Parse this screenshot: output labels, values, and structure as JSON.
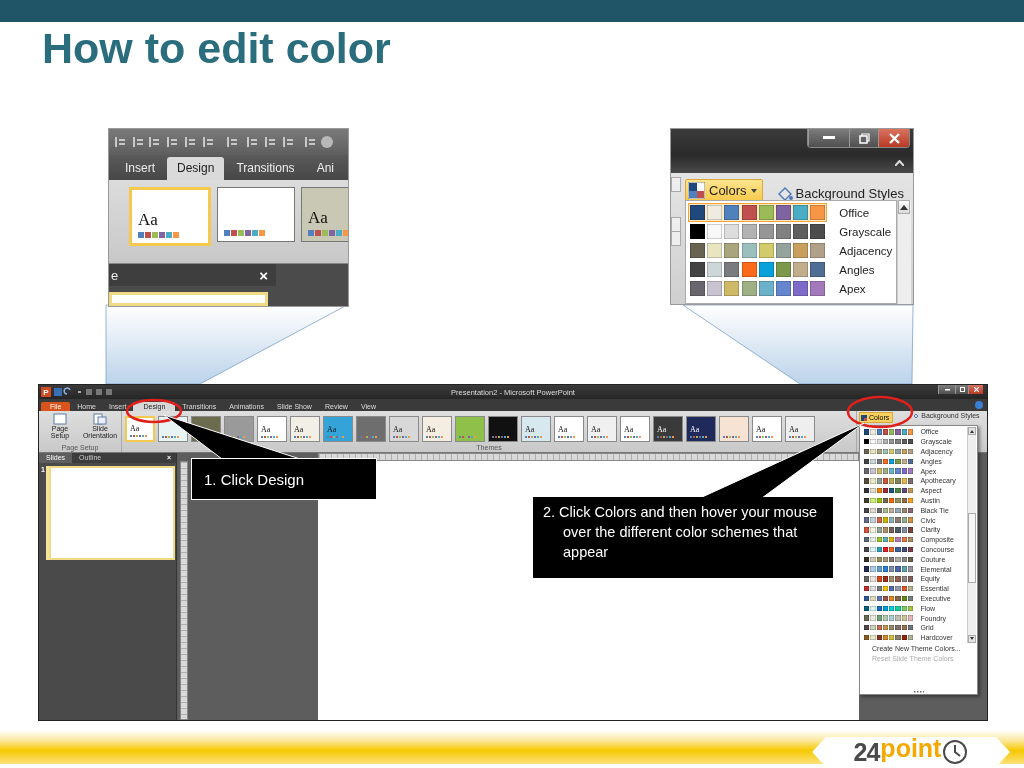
{
  "slide_title": "How to edit color",
  "design_closeup": {
    "tabs": [
      {
        "label": "Insert",
        "selected": false
      },
      {
        "label": "Design",
        "selected": true
      },
      {
        "label": "Transitions",
        "selected": false
      },
      {
        "label": "Ani",
        "selected": false
      }
    ],
    "themes": [
      {
        "label": "Aa",
        "color": "#ffffff",
        "selected": true
      },
      {
        "color": "#ffffff",
        "selected": false
      },
      {
        "label": "Aa",
        "color": "#c9c8b4",
        "selected": false
      }
    ],
    "pane_title": "e",
    "pane_close": "×"
  },
  "colors_closeup": {
    "colors_button": "Colors",
    "background_button": "Background Styles",
    "schemes": [
      {
        "name": "Office",
        "selected": true,
        "swatches": [
          {
            "color": "#1f497d"
          },
          {
            "color": "#eeece1"
          },
          {
            "color": "#4f81bd"
          },
          {
            "color": "#c0504d"
          },
          {
            "color": "#9bbb59"
          },
          {
            "color": "#8064a2"
          },
          {
            "color": "#4bacc6"
          },
          {
            "color": "#f79646"
          }
        ]
      },
      {
        "name": "Grayscale",
        "selected": false,
        "swatches": [
          {
            "color": "#000000"
          },
          {
            "color": "#f8f8f8"
          },
          {
            "color": "#dddddd"
          },
          {
            "color": "#b2b2b2"
          },
          {
            "color": "#969696"
          },
          {
            "color": "#808080"
          },
          {
            "color": "#5f5f5f"
          },
          {
            "color": "#4d4d4d"
          }
        ]
      },
      {
        "name": "Adjacency",
        "selected": false,
        "swatches": [
          {
            "color": "#696451"
          },
          {
            "color": "#e9e5c0"
          },
          {
            "color": "#a9a57c"
          },
          {
            "color": "#9cbebd"
          },
          {
            "color": "#d2cb6c"
          },
          {
            "color": "#95a39d"
          },
          {
            "color": "#c89f5d"
          },
          {
            "color": "#b1a089"
          }
        ]
      },
      {
        "name": "Angles",
        "selected": false,
        "swatches": [
          {
            "color": "#434343"
          },
          {
            "color": "#cdd7d9"
          },
          {
            "color": "#797b7e"
          },
          {
            "color": "#f96a1b"
          },
          {
            "color": "#08a1d9"
          },
          {
            "color": "#7c984a"
          },
          {
            "color": "#c2ad8d"
          },
          {
            "color": "#506e94"
          }
        ]
      },
      {
        "name": "Apex",
        "selected": false,
        "swatches": [
          {
            "color": "#69676d"
          },
          {
            "color": "#c9c2d1"
          },
          {
            "color": "#ceb966"
          },
          {
            "color": "#9cb084"
          },
          {
            "color": "#6bb1c9"
          },
          {
            "color": "#6585cf"
          },
          {
            "color": "#7e6bc9"
          },
          {
            "color": "#a379bb"
          }
        ]
      }
    ]
  },
  "window": {
    "app_icon": "P",
    "title": "Presentation2 - Microsoft PowerPoint",
    "tabs": [
      {
        "label": "File",
        "kind": "backstage",
        "selected": false
      },
      {
        "label": "Home",
        "kind": "tab",
        "selected": false
      },
      {
        "label": "Insert",
        "kind": "tab",
        "selected": false
      },
      {
        "label": "Design",
        "kind": "tab",
        "selected": true
      },
      {
        "label": "Transitions",
        "kind": "tab",
        "selected": false
      },
      {
        "label": "Animations",
        "kind": "tab",
        "selected": false
      },
      {
        "label": "Slide Show",
        "kind": "tab",
        "selected": false
      },
      {
        "label": "Review",
        "kind": "tab",
        "selected": false
      },
      {
        "label": "View",
        "kind": "tab",
        "selected": false
      }
    ],
    "page_setup_buttons": [
      "Page Setup",
      "Slide Orientation"
    ],
    "page_setup_group": "Page Setup",
    "themes": [
      {
        "label": "Aa",
        "color": "#ffffff",
        "selected": true
      },
      {
        "color": "#e8f4f4",
        "selected": false
      },
      {
        "color": "#6b6b4e",
        "selected": false
      },
      {
        "color": "#9a9a9a",
        "selected": false
      },
      {
        "label": "Aa",
        "color": "#ffffff",
        "selected": false
      },
      {
        "label": "Aa",
        "color": "#f2efe6",
        "selected": false
      },
      {
        "label": "Aa",
        "color": "#34a3d8",
        "selected": false
      },
      {
        "color": "#6e6e6e",
        "selected": false
      },
      {
        "label": "Aa",
        "color": "#d8d8d8",
        "selected": false
      },
      {
        "label": "Aa",
        "color": "#f4ede2",
        "selected": false
      },
      {
        "color": "#8fc14a",
        "selected": false
      },
      {
        "color": "#111111",
        "selected": false
      },
      {
        "label": "Aa",
        "color": "#d8e8ef",
        "selected": false
      },
      {
        "label": "Aa",
        "color": "#ffffff",
        "selected": false
      },
      {
        "label": "Aa",
        "color": "#f0f0f0",
        "selected": false
      },
      {
        "label": "Aa",
        "color": "#ffffff",
        "selected": false
      },
      {
        "label": "Aa",
        "color": "#3a3a3a",
        "selected": false
      },
      {
        "label": "Aa",
        "color": "#1f2a5a",
        "selected": false
      },
      {
        "color": "#f7e3d4",
        "selected": false
      },
      {
        "label": "Aa",
        "color": "#ffffff",
        "selected": false
      },
      {
        "label": "Aa",
        "color": "#eeeeee",
        "selected": false
      }
    ],
    "themes_group": "Themes",
    "colors_button": "Colors",
    "background_button": "Background Styles",
    "pane_tabs": [
      {
        "label": "Slides",
        "selected": true
      },
      {
        "label": "Outline",
        "selected": false
      }
    ],
    "pane_close": "×",
    "slide_number": "1",
    "color_menu": {
      "schemes": [
        {
          "name": "Office",
          "swatches": [
            {
              "color": "#1f497d"
            },
            {
              "color": "#eeece1"
            },
            {
              "color": "#4f81bd"
            },
            {
              "color": "#c0504d"
            },
            {
              "color": "#9bbb59"
            },
            {
              "color": "#8064a2"
            },
            {
              "color": "#4bacc6"
            },
            {
              "color": "#f79646"
            }
          ]
        },
        {
          "name": "Grayscale",
          "swatches": [
            {
              "color": "#000000"
            },
            {
              "color": "#f8f8f8"
            },
            {
              "color": "#dddddd"
            },
            {
              "color": "#b2b2b2"
            },
            {
              "color": "#969696"
            },
            {
              "color": "#808080"
            },
            {
              "color": "#5f5f5f"
            },
            {
              "color": "#4d4d4d"
            }
          ]
        },
        {
          "name": "Adjacency",
          "swatches": [
            {
              "color": "#696451"
            },
            {
              "color": "#e9e5c0"
            },
            {
              "color": "#a9a57c"
            },
            {
              "color": "#9cbebd"
            },
            {
              "color": "#d2cb6c"
            },
            {
              "color": "#95a39d"
            },
            {
              "color": "#c89f5d"
            },
            {
              "color": "#b1a089"
            }
          ]
        },
        {
          "name": "Angles",
          "swatches": [
            {
              "color": "#434343"
            },
            {
              "color": "#cdd7d9"
            },
            {
              "color": "#797b7e"
            },
            {
              "color": "#f96a1b"
            },
            {
              "color": "#08a1d9"
            },
            {
              "color": "#7c984a"
            },
            {
              "color": "#c2ad8d"
            },
            {
              "color": "#506e94"
            }
          ]
        },
        {
          "name": "Apex",
          "swatches": [
            {
              "color": "#69676d"
            },
            {
              "color": "#c9c2d1"
            },
            {
              "color": "#ceb966"
            },
            {
              "color": "#9cb084"
            },
            {
              "color": "#6bb1c9"
            },
            {
              "color": "#6585cf"
            },
            {
              "color": "#7e6bc9"
            },
            {
              "color": "#a379bb"
            }
          ]
        },
        {
          "name": "Apothecary",
          "swatches": [
            {
              "color": "#564b3c"
            },
            {
              "color": "#ece9c6"
            },
            {
              "color": "#93a299"
            },
            {
              "color": "#cf543f"
            },
            {
              "color": "#b5ae53"
            },
            {
              "color": "#848058"
            },
            {
              "color": "#e8b54d"
            },
            {
              "color": "#786c71"
            }
          ]
        },
        {
          "name": "Aspect",
          "swatches": [
            {
              "color": "#323232"
            },
            {
              "color": "#e3ded1"
            },
            {
              "color": "#f07f09"
            },
            {
              "color": "#9f2936"
            },
            {
              "color": "#1b587c"
            },
            {
              "color": "#4e8542"
            },
            {
              "color": "#604878"
            },
            {
              "color": "#c19859"
            }
          ]
        },
        {
          "name": "Austin",
          "swatches": [
            {
              "color": "#3e3d2d"
            },
            {
              "color": "#caf278"
            },
            {
              "color": "#94c600"
            },
            {
              "color": "#71685a"
            },
            {
              "color": "#ff6700"
            },
            {
              "color": "#909465"
            },
            {
              "color": "#956b43"
            },
            {
              "color": "#fea022"
            }
          ]
        },
        {
          "name": "Black Tie",
          "swatches": [
            {
              "color": "#46464a"
            },
            {
              "color": "#e3dccf"
            },
            {
              "color": "#6f6f74"
            },
            {
              "color": "#a7b789"
            },
            {
              "color": "#beae98"
            },
            {
              "color": "#92a9b9"
            },
            {
              "color": "#9c8265"
            },
            {
              "color": "#8d6974"
            }
          ]
        },
        {
          "name": "Civic",
          "swatches": [
            {
              "color": "#646b86"
            },
            {
              "color": "#c5d1d7"
            },
            {
              "color": "#d16349"
            },
            {
              "color": "#ccb400"
            },
            {
              "color": "#8cadae"
            },
            {
              "color": "#8c7b70"
            },
            {
              "color": "#8fb08c"
            },
            {
              "color": "#d19049"
            }
          ]
        },
        {
          "name": "Clarity",
          "swatches": [
            {
              "color": "#d2533c"
            },
            {
              "color": "#f3f2dc"
            },
            {
              "color": "#93a299"
            },
            {
              "color": "#ad8f67"
            },
            {
              "color": "#726056"
            },
            {
              "color": "#4c5a6a"
            },
            {
              "color": "#808da0"
            },
            {
              "color": "#79463d"
            }
          ]
        },
        {
          "name": "Composite",
          "swatches": [
            {
              "color": "#5b6973"
            },
            {
              "color": "#e7ecec"
            },
            {
              "color": "#98c723"
            },
            {
              "color": "#59b0b9"
            },
            {
              "color": "#deae00"
            },
            {
              "color": "#b77bb4"
            },
            {
              "color": "#e0773c"
            },
            {
              "color": "#a98d63"
            }
          ]
        },
        {
          "name": "Concourse",
          "swatches": [
            {
              "color": "#464646"
            },
            {
              "color": "#def5fa"
            },
            {
              "color": "#2da2bf"
            },
            {
              "color": "#da1f28"
            },
            {
              "color": "#eb641b"
            },
            {
              "color": "#39639d"
            },
            {
              "color": "#474b78"
            },
            {
              "color": "#7d3c4a"
            }
          ]
        },
        {
          "name": "Couture",
          "swatches": [
            {
              "color": "#37302a"
            },
            {
              "color": "#d0ccb9"
            },
            {
              "color": "#9e8e5c"
            },
            {
              "color": "#a09781"
            },
            {
              "color": "#85776d"
            },
            {
              "color": "#aeafa9"
            },
            {
              "color": "#8d878b"
            },
            {
              "color": "#6b6149"
            }
          ]
        },
        {
          "name": "Elemental",
          "swatches": [
            {
              "color": "#242852"
            },
            {
              "color": "#acccea"
            },
            {
              "color": "#629dd1"
            },
            {
              "color": "#297fd5"
            },
            {
              "color": "#7f8fa9"
            },
            {
              "color": "#4a66ac"
            },
            {
              "color": "#5aa2ae"
            },
            {
              "color": "#9d90a0"
            }
          ]
        },
        {
          "name": "Equity",
          "swatches": [
            {
              "color": "#696464"
            },
            {
              "color": "#e9e5dc"
            },
            {
              "color": "#d34817"
            },
            {
              "color": "#9b2d1f"
            },
            {
              "color": "#a28e6a"
            },
            {
              "color": "#956251"
            },
            {
              "color": "#918485"
            },
            {
              "color": "#855d5d"
            }
          ]
        },
        {
          "name": "Essential",
          "swatches": [
            {
              "color": "#c32d2e"
            },
            {
              "color": "#e0e0e0"
            },
            {
              "color": "#7a7a7a"
            },
            {
              "color": "#f5c201"
            },
            {
              "color": "#526db0"
            },
            {
              "color": "#989aac"
            },
            {
              "color": "#dc5924"
            },
            {
              "color": "#b4b392"
            }
          ]
        },
        {
          "name": "Executive",
          "swatches": [
            {
              "color": "#2f5897"
            },
            {
              "color": "#dfdcb7"
            },
            {
              "color": "#6076b4"
            },
            {
              "color": "#9c5252"
            },
            {
              "color": "#e68422"
            },
            {
              "color": "#846648"
            },
            {
              "color": "#63891f"
            },
            {
              "color": "#758085"
            }
          ]
        },
        {
          "name": "Flow",
          "swatches": [
            {
              "color": "#04617b"
            },
            {
              "color": "#dbf5f9"
            },
            {
              "color": "#0f6fc6"
            },
            {
              "color": "#009dd9"
            },
            {
              "color": "#0bd0d9"
            },
            {
              "color": "#10cf9b"
            },
            {
              "color": "#7cca62"
            },
            {
              "color": "#a5c249"
            }
          ]
        },
        {
          "name": "Foundry",
          "swatches": [
            {
              "color": "#676a55"
            },
            {
              "color": "#eaebde"
            },
            {
              "color": "#72a376"
            },
            {
              "color": "#b0ccb0"
            },
            {
              "color": "#a8cdd7"
            },
            {
              "color": "#c0beaf"
            },
            {
              "color": "#cec597"
            },
            {
              "color": "#e8b7b7"
            }
          ]
        },
        {
          "name": "Grid",
          "swatches": [
            {
              "color": "#534949"
            },
            {
              "color": "#ccd1b9"
            },
            {
              "color": "#c66951"
            },
            {
              "color": "#bf974d"
            },
            {
              "color": "#928b70"
            },
            {
              "color": "#87706b"
            },
            {
              "color": "#94734e"
            },
            {
              "color": "#6f777d"
            }
          ]
        },
        {
          "name": "Hardcover",
          "swatches": [
            {
              "color": "#895d1d"
            },
            {
              "color": "#ece9c6"
            },
            {
              "color": "#873624"
            },
            {
              "color": "#d6862d"
            },
            {
              "color": "#d0be40"
            },
            {
              "color": "#877f6c"
            },
            {
              "color": "#972109"
            },
            {
              "color": "#aeb795"
            }
          ]
        }
      ],
      "actions": [
        {
          "label": "Create New Theme Colors...",
          "disabled": false
        },
        {
          "label": "Reset Slide Theme Colors",
          "disabled": true
        }
      ]
    }
  },
  "callouts": [
    {
      "text": "1. Click Design"
    },
    {
      "text": "2. Click Colors and then hover your mouse over the different color schemes that appear"
    }
  ],
  "logo": {
    "number": "24",
    "word": "point"
  }
}
